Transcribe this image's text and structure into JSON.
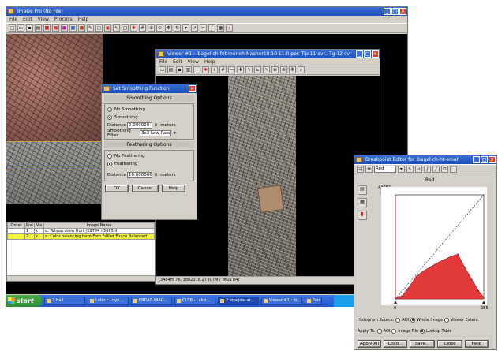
{
  "main_window": {
    "title": "ImaGe Pro (No File)",
    "menu": [
      "File",
      "Edit",
      "View",
      "Process",
      "Help"
    ]
  },
  "layers_panel": {
    "columns": [
      "Order",
      "Pixl",
      "Vis",
      "Image Name"
    ],
    "rows": [
      {
        "order": "",
        "pixl": "1",
        "vis": "x",
        "name": "a: Tehran stem Hurt (28784 / 3085 it"
      },
      {
        "order": "",
        "pixl": "2",
        "vis": "x",
        "name": "a: Color balancing term Fom Fdlilet Flu ce Balanced"
      }
    ]
  },
  "smoothing_dialog": {
    "title": "Set Smoothing Function",
    "smoothing_header": "Smoothing Options",
    "no_smoothing": "No Smoothing",
    "smoothing": "Smoothing",
    "distance_label": "Distance",
    "distance_value": "0.000000",
    "unit": "meters",
    "filter_label": "Smoothing Filter",
    "filter_value": "3x3 Low-Pass",
    "feathering_header": "Feathering Options",
    "no_feathering": "No Feathering",
    "feathering": "Feathering",
    "feather_distance_value": "10.000000",
    "ok": "OK",
    "cancel": "Cancel",
    "help": "Help"
  },
  "viewer": {
    "title": "Viewer #1 : ibagel-ch-fot-meneh-Naaher10.10 11.0 ppr. Tlp:11 avr.. Tg 12 cvr",
    "status": "(3484m 76, 3882378.27  (UTM / WGS 84)"
  },
  "breakpoint_editor": {
    "title": "Breakpoint Editor for ibagel-ch-ht-emeh",
    "channel_select": "Red",
    "graph_title": "Red",
    "y_top_label": "43062",
    "y_top_value": "255",
    "x_min": "0",
    "x_max": "255",
    "histogram_source_label": "Histogram Source:",
    "hist_opt_aoi": "AOI",
    "hist_opt_whole": "Whole Image",
    "hist_opt_viewer": "Viewer Extent",
    "apply_to_label": "Apply To:",
    "apply_opt_aoi": "AOI",
    "apply_opt_file": "Image File",
    "apply_opt_lut": "Lookup Table",
    "btn_apply_all": "Apply All",
    "btn_load": "Load...",
    "btn_save": "Save...",
    "btn_close": "Close",
    "btn_help": "Help"
  },
  "taskbar": {
    "start": "start",
    "items": [
      "2 Hall",
      "Latin t - dyy ...",
      "ERDAS IMAG...",
      "CLSB - Lakis...",
      "2 Imagine-ar...",
      "Viewer #1 : ib...",
      "Pan..."
    ],
    "clock": ""
  },
  "chart_data": {
    "type": "area",
    "title": "Red",
    "xlim": [
      0,
      255
    ],
    "ylim": [
      0,
      255
    ],
    "x": [
      0,
      20,
      40,
      60,
      80,
      100,
      120,
      140,
      160,
      180,
      200,
      220,
      240,
      255
    ],
    "histogram": [
      2,
      8,
      30,
      55,
      68,
      78,
      88,
      96,
      104,
      110,
      78,
      48,
      20,
      4
    ],
    "lookup_line": [
      [
        0,
        0
      ],
      [
        255,
        255
      ]
    ]
  }
}
